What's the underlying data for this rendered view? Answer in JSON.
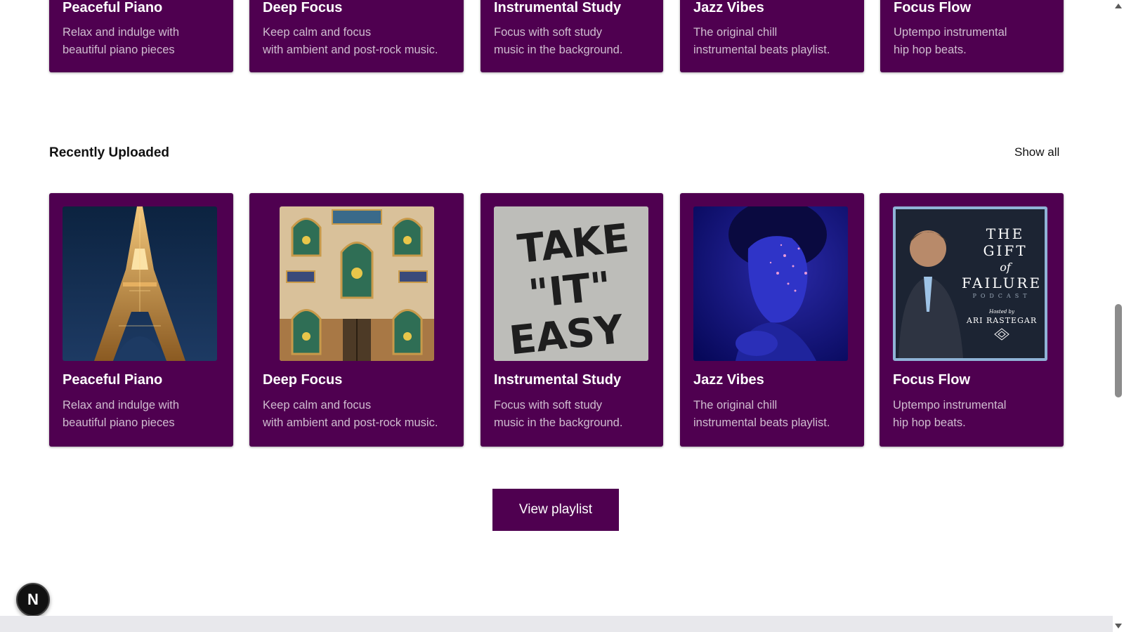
{
  "top_row": [
    {
      "title": "Peaceful Piano",
      "desc": [
        "Relax and indulge with",
        "beautiful piano pieces"
      ]
    },
    {
      "title": "Deep Focus",
      "desc": [
        "Keep calm and focus",
        "with ambient and post-rock music."
      ]
    },
    {
      "title": "Instrumental Study",
      "desc": [
        "Focus with soft study",
        "music in the background."
      ]
    },
    {
      "title": "Jazz Vibes",
      "desc": [
        "The original chill",
        "instrumental beats playlist."
      ]
    },
    {
      "title": "Focus Flow",
      "desc": [
        "Uptempo instrumental",
        "hip hop beats."
      ]
    }
  ],
  "recent": {
    "title": "Recently Uploaded",
    "show_all": "Show all",
    "cards": [
      {
        "title": "Peaceful Piano",
        "desc": [
          "Relax and indulge with",
          "beautiful piano pieces"
        ],
        "cover": "eiffel-tower-night"
      },
      {
        "title": "Deep Focus",
        "desc": [
          "Keep calm and focus",
          "with ambient and post-rock music."
        ],
        "cover": "tiled-mosaic-wall"
      },
      {
        "title": "Instrumental Study",
        "desc": [
          "Focus with soft study",
          "music in the background."
        ],
        "cover": "graffiti-wall",
        "cover_text": {
          "line1": "TAKE",
          "line2": "\"IT\"",
          "line3": "EASY"
        }
      },
      {
        "title": "Jazz Vibes",
        "desc": [
          "The original chill",
          "instrumental beats playlist."
        ],
        "cover": "blue-glitter-portrait"
      },
      {
        "title": "Focus Flow",
        "desc": [
          "Uptempo instrumental",
          "hip hop beats."
        ],
        "cover": "podcast-cover",
        "cover_text": {
          "the": "THE",
          "gift": "GIFT",
          "of": "of",
          "failure": "FAILURE",
          "podcast": "PODCAST",
          "hosted": "Hosted by",
          "host": "ARI RASTEGAR"
        }
      }
    ]
  },
  "view_playlist": "View playlist",
  "fab_letter": "N",
  "colors": {
    "card_bg": "#4f0050",
    "card_desc": "#cfbccf",
    "page_bg": "#ffffff"
  }
}
